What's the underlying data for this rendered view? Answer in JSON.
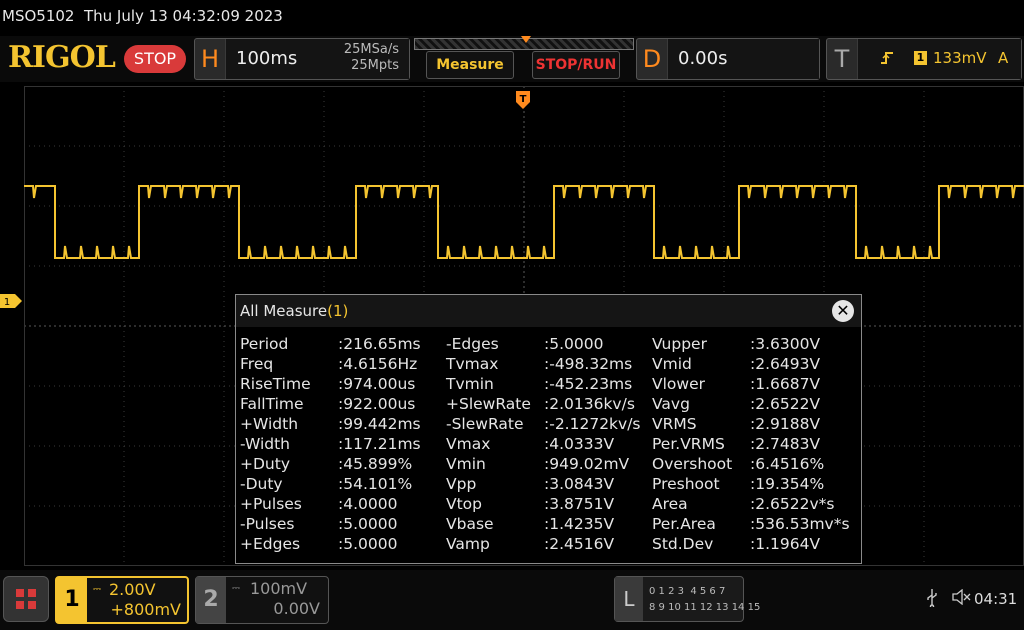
{
  "status": {
    "text": "MSO5102  Thu July 13 04:32:09 2023"
  },
  "toolbar": {
    "logo": "RIGOL",
    "run_state": "STOP",
    "horizontal": {
      "letter": "H",
      "timebase": "100ms",
      "sample_rate": "25MSa/s",
      "memory_depth": "25Mpts"
    },
    "measure_label": "Measure",
    "stoprun_label": "STOP/RUN",
    "delay": {
      "letter": "D",
      "value": "0.00s"
    },
    "trigger": {
      "letter": "T",
      "edge_icon": "rising-edge-icon",
      "source": "1",
      "level": "133mV",
      "mode": "A"
    }
  },
  "markers": {
    "ch1": "1",
    "trigger_pos": "T"
  },
  "measure_panel": {
    "title": "All Measure",
    "count": "(1)",
    "rows": [
      [
        "Period",
        ":216.65ms",
        "-Edges",
        ":5.0000",
        "Vupper",
        ":3.6300V"
      ],
      [
        "Freq",
        ":4.6156Hz",
        "Tvmax",
        ":-498.32ms",
        "Vmid",
        ":2.6493V"
      ],
      [
        "RiseTime",
        ":974.00us",
        "Tvmin",
        ":-452.23ms",
        "Vlower",
        ":1.6687V"
      ],
      [
        "FallTime",
        ":922.00us",
        "+SlewRate",
        ":2.0136kv/s",
        "Vavg",
        ":2.6522V"
      ],
      [
        "+Width",
        ":99.442ms",
        "-SlewRate",
        ":-2.1272kv/s",
        "VRMS",
        ":2.9188V"
      ],
      [
        "-Width",
        ":117.21ms",
        "Vmax",
        ":4.0333V",
        "Per.VRMS",
        ":2.7483V"
      ],
      [
        "+Duty",
        ":45.899%",
        "Vmin",
        ":949.02mV",
        "Overshoot",
        ":6.4516%"
      ],
      [
        "-Duty",
        ":54.101%",
        "Vpp",
        ":3.0843V",
        "Preshoot",
        ":19.354%"
      ],
      [
        "+Pulses",
        ":4.0000",
        "Vtop",
        ":3.8751V",
        "Area",
        ":2.6522v*s"
      ],
      [
        "-Pulses",
        ":5.0000",
        "Vbase",
        ":1.4235V",
        "Per.Area",
        ":536.53mv*s"
      ],
      [
        "+Edges",
        ":5.0000",
        "Vamp",
        ":2.4516V",
        "Std.Dev",
        ":1.1964V"
      ]
    ]
  },
  "bottom": {
    "ch1": {
      "num": "1",
      "scale": "2.00V",
      "offset": "+800mV"
    },
    "ch2": {
      "num": "2",
      "scale": "100mV",
      "offset": "0.00V"
    },
    "la": {
      "letter": "L",
      "row1": "0 1 2 3  4 5 6 7",
      "row2": "8 9 10 11 12 13 14 15"
    },
    "clock": "04:31"
  },
  "colors": {
    "ch1": "#f4c430",
    "stop": "#d93a3a",
    "accent": "#ff8a1e"
  }
}
